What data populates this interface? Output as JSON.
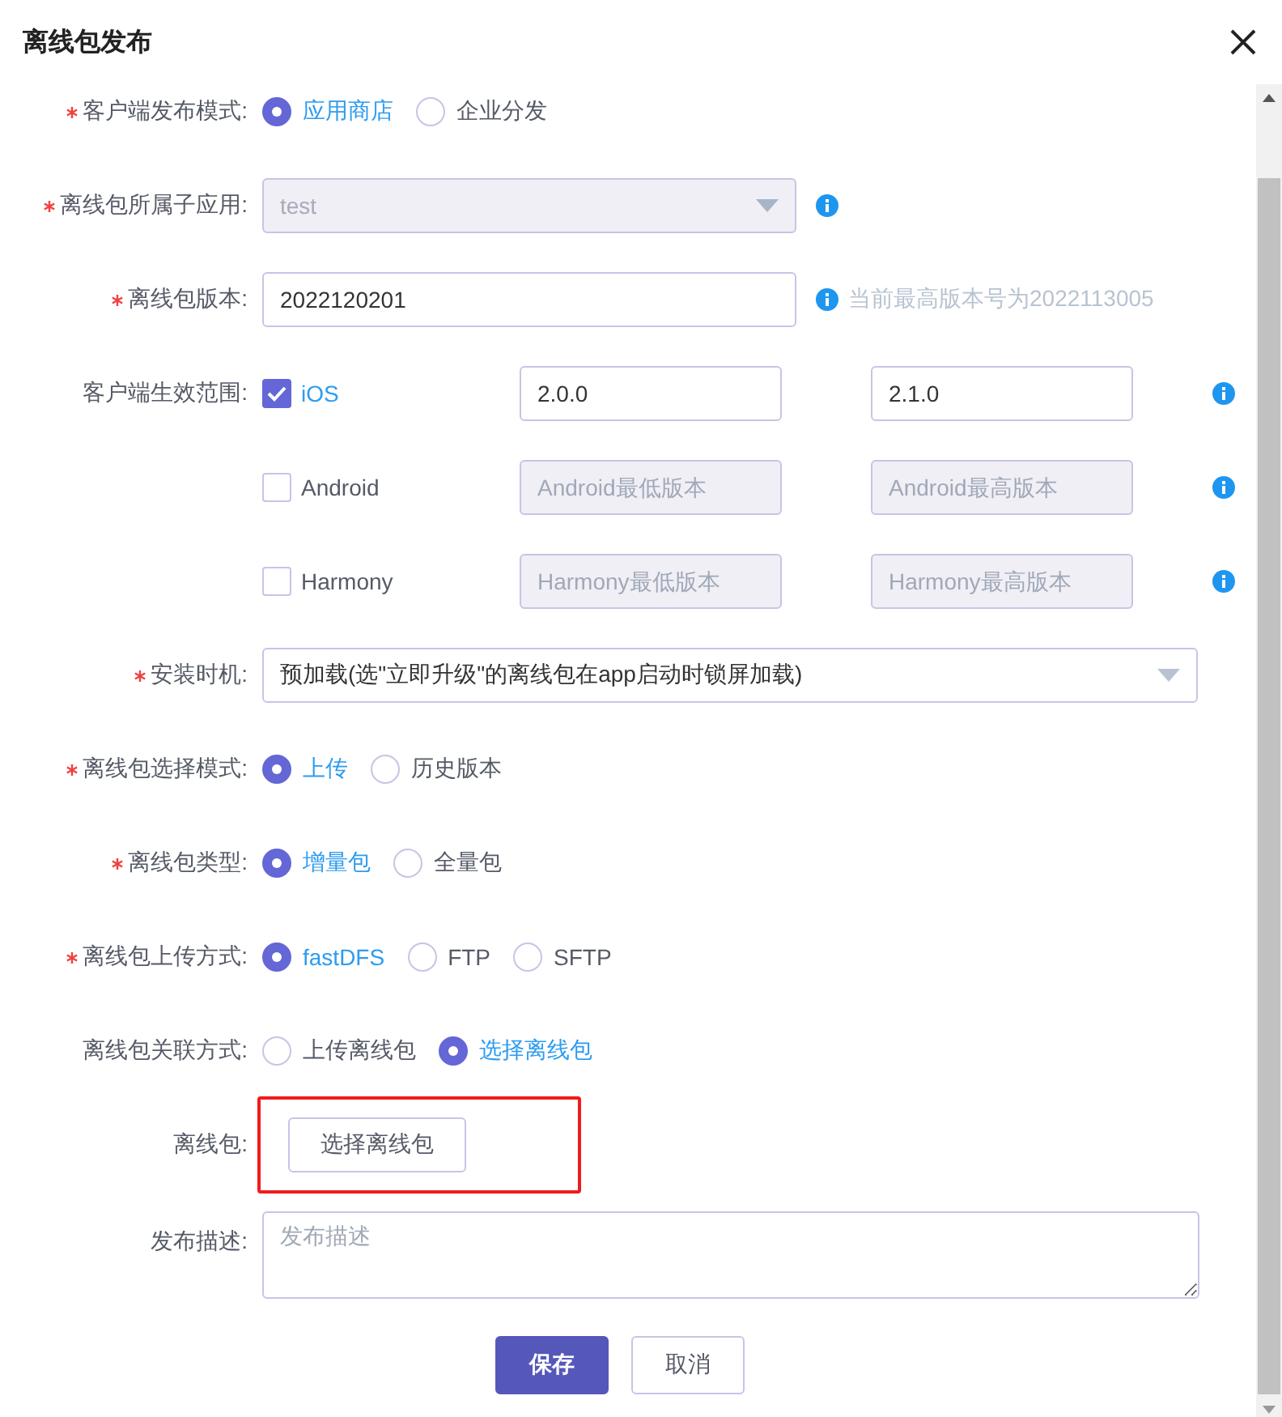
{
  "dialog": {
    "title": "离线包发布"
  },
  "fields": [
    {
      "kind": "radio",
      "label": "客户端发布模式:",
      "required": true,
      "options": [
        {
          "label": "应用商店",
          "selected": true
        },
        {
          "label": "企业分发",
          "selected": false
        }
      ]
    },
    {
      "kind": "select",
      "label": "离线包所属子应用:",
      "required": true,
      "value": "test",
      "disabled": true,
      "info": true
    },
    {
      "kind": "input",
      "label": "离线包版本:",
      "required": true,
      "value": "2022120201",
      "hint": "当前最高版本号为2022113005"
    },
    {
      "kind": "platforms",
      "label": "客户端生效范围:",
      "required": false,
      "platforms": [
        {
          "name": "iOS",
          "checked": true,
          "min": {
            "value": "2.0.0"
          },
          "max": {
            "value": "2.1.0"
          }
        },
        {
          "name": "Android",
          "checked": false,
          "min": {
            "placeholder": "Android最低版本"
          },
          "max": {
            "placeholder": "Android最高版本"
          }
        },
        {
          "name": "Harmony",
          "checked": false,
          "min": {
            "placeholder": "Harmony最低版本"
          },
          "max": {
            "placeholder": "Harmony最高版本"
          }
        }
      ]
    },
    {
      "kind": "select",
      "label": "安装时机:",
      "required": true,
      "value": "预加载(选\"立即升级\"的离线包在app启动时锁屏加载)",
      "disabled": false,
      "info": false
    },
    {
      "kind": "radio",
      "label": "离线包选择模式:",
      "required": true,
      "options": [
        {
          "label": "上传",
          "selected": true
        },
        {
          "label": "历史版本",
          "selected": false
        }
      ]
    },
    {
      "kind": "radio",
      "label": "离线包类型:",
      "required": true,
      "options": [
        {
          "label": "增量包",
          "selected": true
        },
        {
          "label": "全量包",
          "selected": false
        }
      ]
    },
    {
      "kind": "radio",
      "label": "离线包上传方式:",
      "required": true,
      "options": [
        {
          "label": "fastDFS",
          "selected": true
        },
        {
          "label": "FTP",
          "selected": false
        },
        {
          "label": "SFTP",
          "selected": false
        }
      ]
    },
    {
      "kind": "radio",
      "label": "离线包关联方式:",
      "required": false,
      "options": [
        {
          "label": "上传离线包",
          "selected": false
        },
        {
          "label": "选择离线包",
          "selected": true
        }
      ]
    },
    {
      "kind": "picker",
      "label": "离线包:",
      "required": false,
      "button": "选择离线包",
      "highlighted": true
    },
    {
      "kind": "textarea",
      "label": "发布描述:",
      "required": false,
      "placeholder": "发布描述"
    }
  ],
  "actions": [
    {
      "label": "保存",
      "primary": true
    },
    {
      "label": "取消",
      "primary": false
    }
  ]
}
